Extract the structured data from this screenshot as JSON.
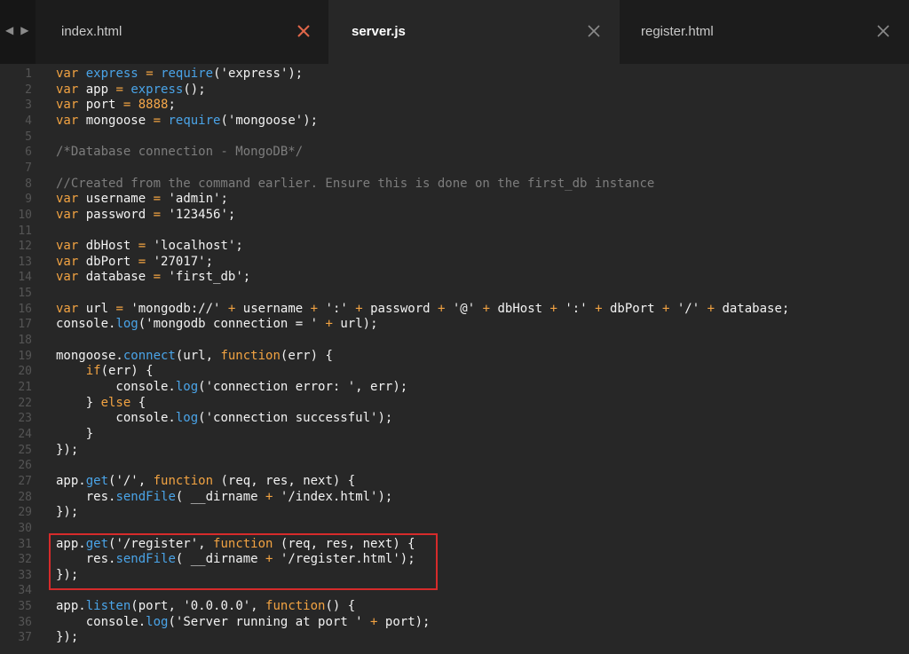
{
  "tabs": [
    {
      "label": "index.html",
      "close": "✕"
    },
    {
      "label": "server.js",
      "close": "✕"
    },
    {
      "label": "register.html",
      "close": "✕"
    }
  ],
  "nav": {
    "back": "◀",
    "forward": "▶"
  },
  "lines": [
    "var express = require('express');",
    "var app = express();",
    "var port = 8888;",
    "var mongoose = require('mongoose');",
    "",
    "/*Database connection - MongoDB*/",
    "",
    "//Created from the command earlier. Ensure this is done on the first_db instance",
    "var username = 'admin';",
    "var password = '123456';",
    "",
    "var dbHost = 'localhost';",
    "var dbPort = '27017';",
    "var database = 'first_db';",
    "",
    "var url = 'mongodb://' + username + ':' + password + '@' + dbHost + ':' + dbPort + '/' + database;",
    "console.log('mongodb connection = ' + url);",
    "",
    "mongoose.connect(url, function(err) {",
    "    if(err) {",
    "        console.log('connection error: ', err);",
    "    } else {",
    "        console.log('connection successful');",
    "    }",
    "});",
    "",
    "app.get('/', function (req, res, next) {",
    "    res.sendFile( __dirname + '/index.html');",
    "});",
    "",
    "app.get('/register', function (req, res, next) {",
    "    res.sendFile( __dirname + '/register.html');",
    "});",
    "",
    "app.listen(port, '0.0.0.0', function() {",
    "    console.log('Server running at port ' + port);",
    "});"
  ],
  "line_numbers": [
    "1",
    "2",
    "3",
    "4",
    "5",
    "6",
    "7",
    "8",
    "9",
    "10",
    "11",
    "12",
    "13",
    "14",
    "15",
    "16",
    "17",
    "18",
    "19",
    "20",
    "21",
    "22",
    "23",
    "24",
    "25",
    "26",
    "27",
    "28",
    "29",
    "30",
    "31",
    "32",
    "33",
    "34",
    "35",
    "36",
    "37"
  ],
  "colors": {
    "keyword": "#4aa4e8",
    "string": "#f2f2f2",
    "comment": "#7d7d7d",
    "number": "#f7a84a",
    "highlight": "#d62b2b",
    "active_tab_close": "#e0664a"
  }
}
